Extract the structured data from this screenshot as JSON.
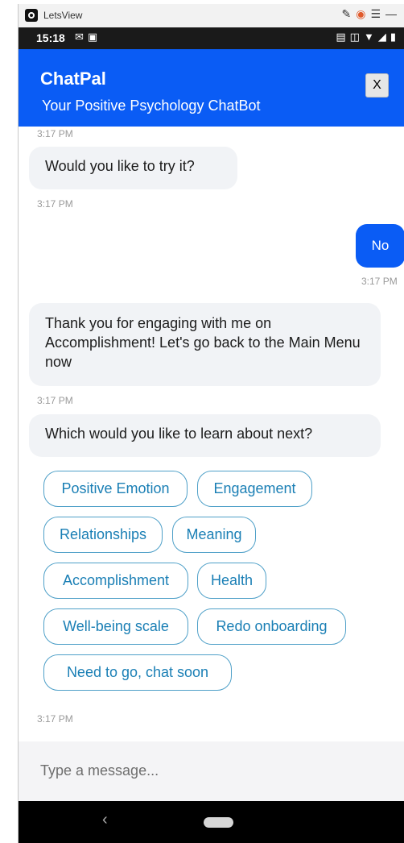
{
  "window": {
    "title": "LetsView",
    "controls": [
      "brush-icon",
      "record-icon",
      "menu-icon",
      "minimize-icon"
    ]
  },
  "status_bar": {
    "time": "15:18"
  },
  "header": {
    "title": "ChatPal",
    "subtitle": "Your Positive Psychology ChatBot",
    "close_label": "X"
  },
  "messages": {
    "ts_top": "3:17 PM",
    "m1": "Would you like to try it?",
    "ts1": "3:17 PM",
    "user_reply": "No",
    "ts_user": "3:17 PM",
    "m2": "Thank you for engaging with me on Accomplishment! Let's go back to the Main Menu now",
    "ts2": "3:17 PM",
    "m3": "Which would you like to learn about next?",
    "ts_bottom": "3:17 PM"
  },
  "options": [
    "Positive Emotion",
    "Engagement",
    "Relationships",
    "Meaning",
    "Accomplishment",
    "Health",
    "Well-being scale",
    "Redo onboarding",
    "Need to go, chat soon"
  ],
  "input": {
    "placeholder": "Type a message..."
  }
}
